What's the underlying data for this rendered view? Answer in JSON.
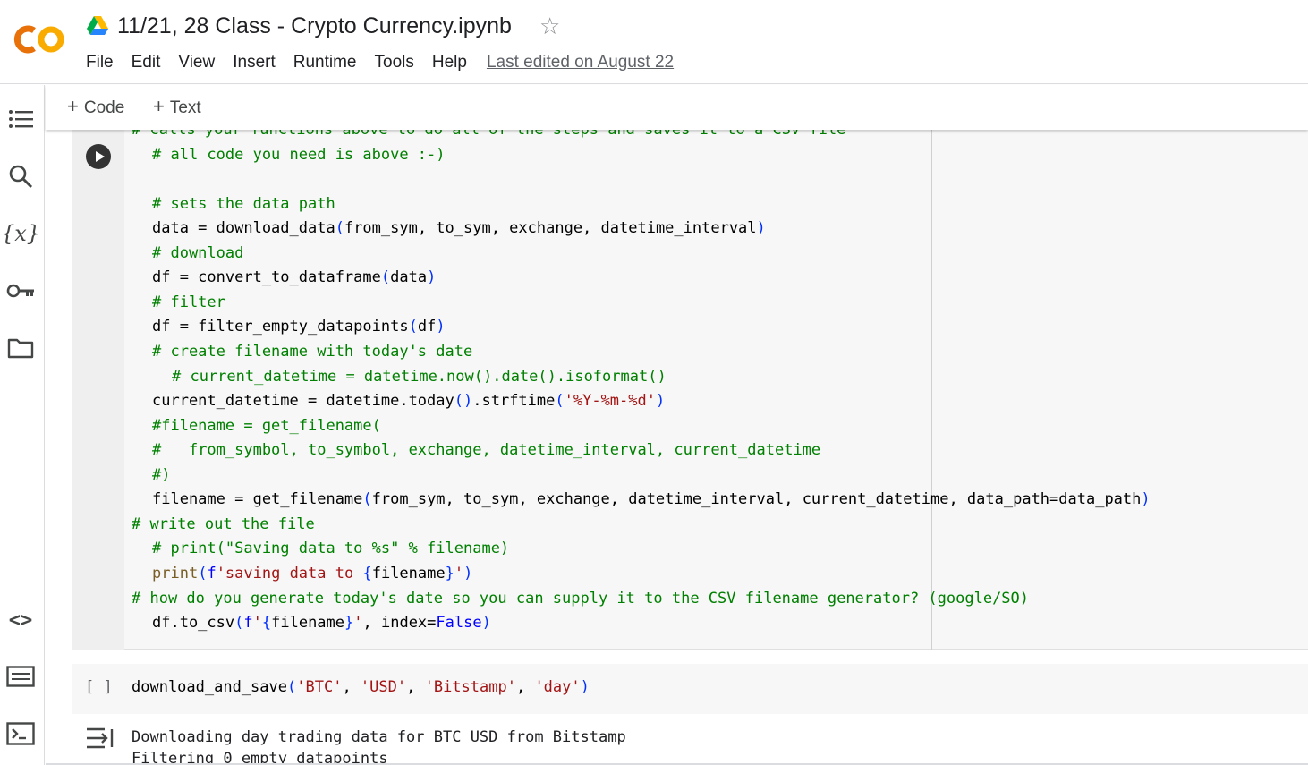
{
  "app": {
    "logo_text": "CO",
    "notebook_title": "11/21, 28 Class - Crypto Currency.ipynb",
    "menu": [
      "File",
      "Edit",
      "View",
      "Insert",
      "Runtime",
      "Tools",
      "Help"
    ],
    "last_edited": "Last edited on August 22"
  },
  "toolbar": {
    "add_code_label": "Code",
    "add_text_label": "Text"
  },
  "sidebar": {
    "icons": [
      "table-of-contents-icon",
      "search-icon",
      "variables-icon",
      "secrets-key-icon",
      "files-folder-icon",
      "code-snippets-icon",
      "command-palette-icon",
      "terminal-icon"
    ]
  },
  "cell1": {
    "lines": [
      "# calls your functions above to do all of the steps and saves it to a CSV file",
      "# all code you need is above :-)",
      "# sets the data path",
      "data = download_data(from_sym, to_sym, exchange, datetime_interval)",
      "# download",
      "df = convert_to_dataframe(data)",
      "# filter",
      "df = filter_empty_datapoints(df)",
      "# create filename with today's date",
      "# current_datetime = datetime.now().date().isoformat()",
      "current_datetime = datetime.today().strftime('%Y-%m-%d')",
      "#filename = get_filename(",
      "#   from_symbol, to_symbol, exchange, datetime_interval, current_datetime",
      "#)",
      "filename = get_filename(from_sym, to_sym, exchange, datetime_interval, current_datetime, data_path=data_path)",
      "# write out the file",
      "# print(\"Saving data to %s\" % filename)",
      "print(f'saving data to {filename}')",
      "# how do you generate today's date so you can supply it to the CSV filename generator? (google/SO)",
      "df.to_csv(f'{filename}', index=False)"
    ]
  },
  "cell2": {
    "exec_marker": "[ ]",
    "code": "download_and_save('BTC', 'USD', 'Bitstamp', 'day')"
  },
  "output": {
    "lines": [
      "Downloading day trading data for BTC USD from Bitstamp",
      "Filtering 0 empty datapoints"
    ]
  }
}
